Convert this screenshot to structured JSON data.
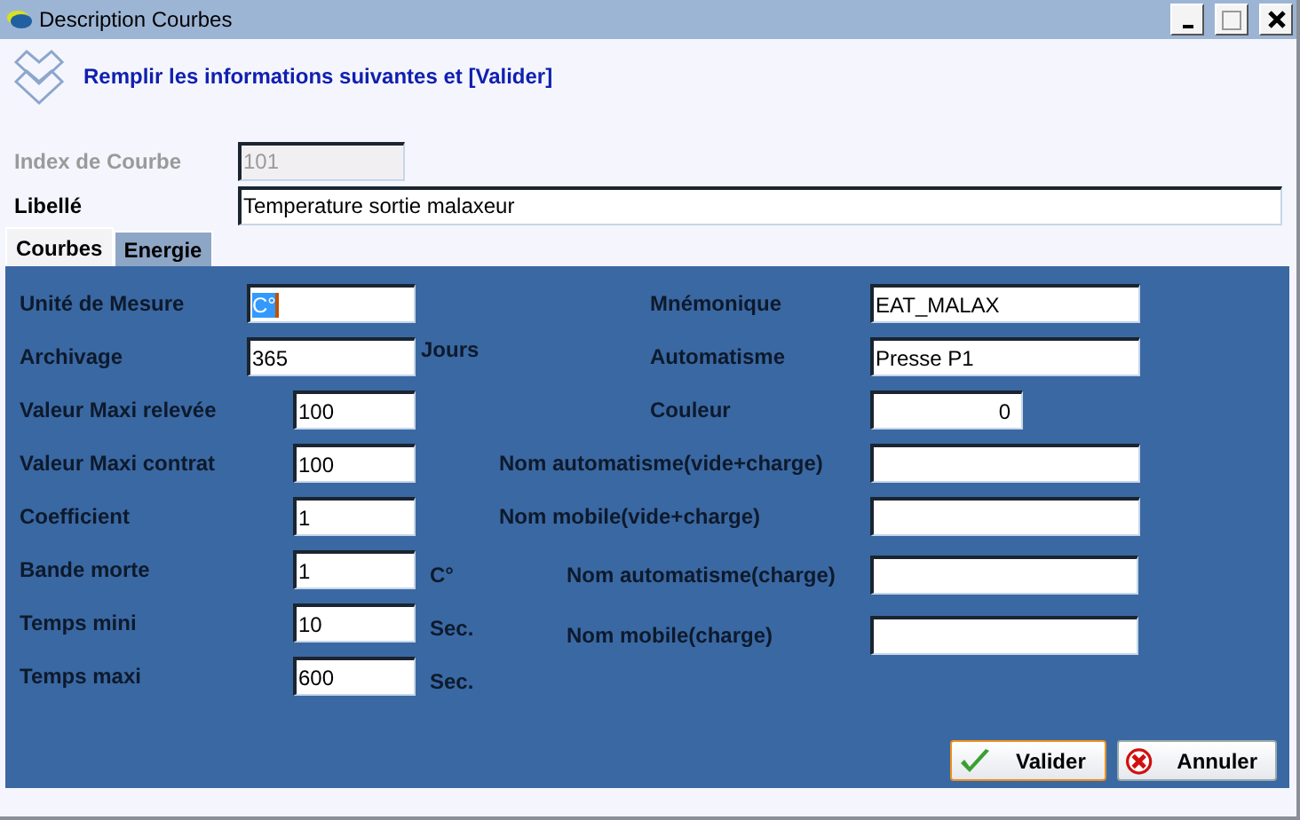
{
  "window": {
    "title": "Description Courbes"
  },
  "header": {
    "text": "Remplir les informations suivantes et [Valider]"
  },
  "index_field": {
    "label": "Index de Courbe",
    "value": "101",
    "disabled": true
  },
  "libelle_field": {
    "label": "Libellé",
    "value": "Temperature sortie malaxeur",
    "disabled": false
  },
  "tabs": [
    {
      "label": "Courbes",
      "selected": true
    },
    {
      "label": "Energie",
      "selected": false
    }
  ],
  "left_fields": [
    {
      "label": "Unité de Mesure",
      "value": "C°",
      "text_selected": true
    },
    {
      "label": "Archivage",
      "value": "365",
      "unit": "Jours",
      "text_selected": false
    },
    {
      "label": "Valeur Maxi relevée",
      "value": "100",
      "text_selected": false
    },
    {
      "label": "Valeur Maxi contrat",
      "value": "100",
      "text_selected": false
    },
    {
      "label": "Coefficient",
      "value": "1",
      "text_selected": false
    },
    {
      "label": "Bande morte",
      "value": "1",
      "unit": "C°",
      "text_selected": false
    },
    {
      "label": "Temps mini",
      "value": "10",
      "unit": "Sec.",
      "text_selected": false
    },
    {
      "label": "Temps maxi",
      "value": "600",
      "unit": "Sec.",
      "text_selected": false
    }
  ],
  "right_fields": [
    {
      "label": "Mnémonique",
      "value": "EAT_MALAX",
      "kind": "text"
    },
    {
      "label": "Automatisme",
      "value": "Presse P1",
      "kind": "text"
    },
    {
      "label": "Couleur",
      "value": "0",
      "kind": "number"
    },
    {
      "label": "Nom automatisme(vide+charge)",
      "kind": "text"
    },
    {
      "label": "Nom mobile(vide+charge)",
      "kind": "text"
    },
    {
      "label": "Nom automatisme(charge)",
      "kind": "text"
    },
    {
      "label": "Nom mobile(charge)",
      "kind": "text"
    }
  ],
  "buttons": [
    {
      "label": "Valider",
      "kind": "ok",
      "default": true
    },
    {
      "label": "Annuler",
      "kind": "cancel",
      "default": false
    }
  ]
}
